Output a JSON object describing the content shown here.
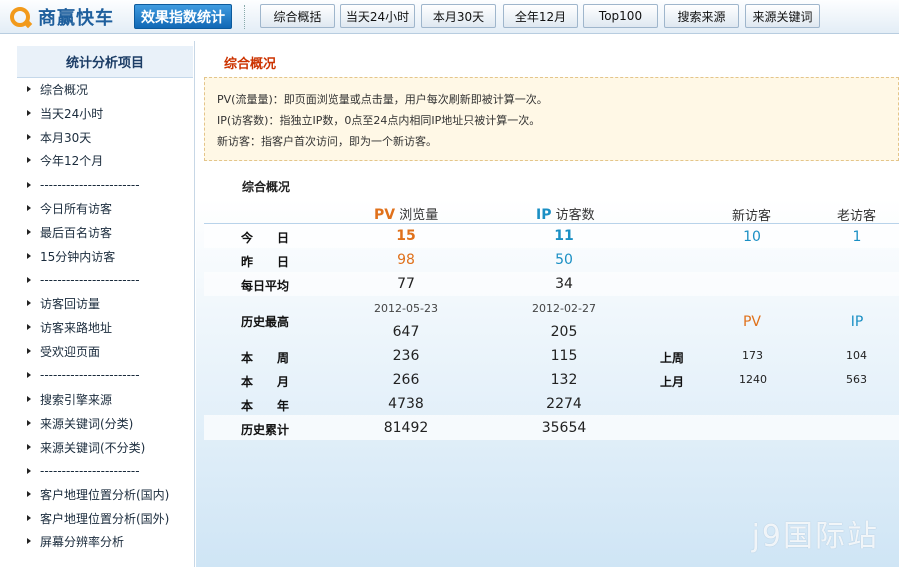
{
  "header": {
    "logo_text": "商赢快车",
    "product_badge": "效果指数统计",
    "tabs": [
      {
        "label": "综合概括"
      },
      {
        "label": "当天24小时"
      },
      {
        "label": "本月30天"
      },
      {
        "label": "全年12月"
      },
      {
        "label": "Top100"
      },
      {
        "label": "搜索来源"
      },
      {
        "label": "来源关键词"
      }
    ]
  },
  "sidebar": {
    "title": "统计分析项目",
    "items": [
      {
        "label": "综合概况"
      },
      {
        "label": "当天24小时"
      },
      {
        "label": "本月30天"
      },
      {
        "label": "今年12个月"
      },
      {
        "label": "-----------------------"
      },
      {
        "label": "今日所有访客"
      },
      {
        "label": "最后百名访客"
      },
      {
        "label": "15分钟内访客"
      },
      {
        "label": "-----------------------"
      },
      {
        "label": "访客回访量"
      },
      {
        "label": "访客来路地址"
      },
      {
        "label": "受欢迎页面"
      },
      {
        "label": "-----------------------"
      },
      {
        "label": "搜索引擎来源"
      },
      {
        "label": "来源关键词(分类)"
      },
      {
        "label": "来源关键词(不分类)"
      },
      {
        "label": "-----------------------"
      },
      {
        "label": "客户地理位置分析(国内)"
      },
      {
        "label": "客户地理位置分析(国外)"
      },
      {
        "label": "屏幕分辨率分析"
      }
    ]
  },
  "main": {
    "section_title": "综合概况",
    "notice": [
      "PV(流量量)：即页面浏览量或点击量，用户每次刷新即被计算一次。",
      "IP(访客数)：指独立IP数，0点至24点内相同IP地址只被计算一次。",
      "新访客：指客户首次访问，即为一个新访客。"
    ],
    "stats_heading": "综合概况",
    "columns": {
      "pv_abbr": "PV",
      "pv_label": "浏览量",
      "ip_abbr": "IP",
      "ip_label": "访客数",
      "new_visitors": "新访客",
      "old_visitors": "老访客"
    },
    "rows": {
      "today": {
        "label": "今　　日",
        "pv": "15",
        "ip": "11",
        "new": "10",
        "old": "1"
      },
      "yesterday": {
        "label": "昨　　日",
        "pv": "98",
        "ip": "50"
      },
      "daily_avg": {
        "label": "每日平均",
        "pv": "77",
        "ip": "34"
      },
      "history_max": {
        "label": "历史最高",
        "pv_date": "2012-05-23",
        "ip_date": "2012-02-27",
        "pv": "647",
        "ip": "205",
        "side_pv": "PV",
        "side_ip": "IP"
      },
      "this_week": {
        "label": "本　　周",
        "pv": "236",
        "ip": "115",
        "side_label": "上周",
        "side_pv": "173",
        "side_ip": "104"
      },
      "this_month": {
        "label": "本　　月",
        "pv": "266",
        "ip": "132",
        "side_label": "上月",
        "side_pv": "1240",
        "side_ip": "563"
      },
      "this_year": {
        "label": "本　　年",
        "pv": "4738",
        "ip": "2274"
      },
      "history_total": {
        "label": "历史累计",
        "pv": "81492",
        "ip": "35654"
      }
    },
    "colors": {
      "pv": "#e0711b",
      "ip": "#1a8fc4",
      "title": "#cc3300"
    }
  },
  "watermark": "j9国际站"
}
